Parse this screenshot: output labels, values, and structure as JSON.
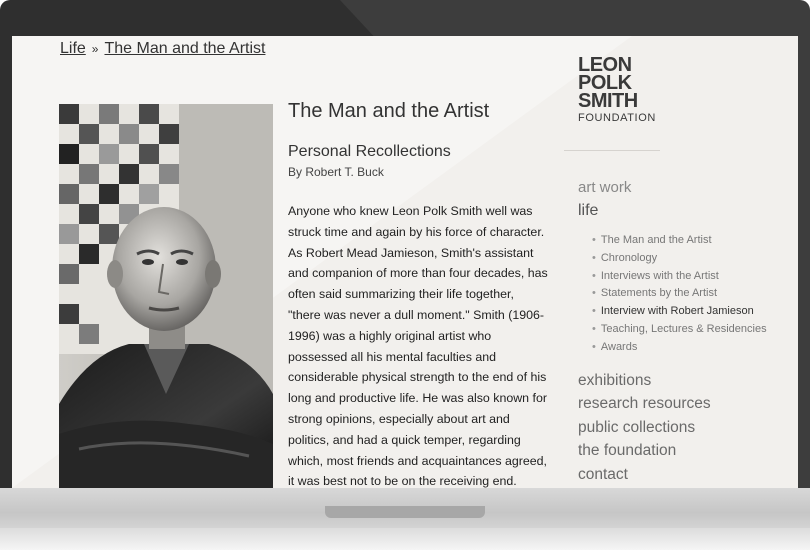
{
  "breadcrumb": {
    "root": "Life",
    "separator": "»",
    "current": "The Man and the Artist"
  },
  "logo": {
    "line1": "LEON",
    "line2": "POLK",
    "line3": "SMITH",
    "line4": "FOUNDATION"
  },
  "article": {
    "title": "The Man and the Artist",
    "subtitle": "Personal Recollections",
    "byline": "By Robert T. Buck",
    "body": "Anyone who knew Leon Polk Smith well was struck time and again by his force of character. As Robert Mead Jamieson, Smith's assistant and companion of more than four decades, has often said summarizing their life together, \"there was never a dull moment.\" Smith (1906-1996) was a highly original artist who possessed all his mental faculties and considerable physical strength to the end of his long and productive life. He was also known for strong opinions, especially about art and politics, and had a quick temper, regarding which, most friends and acquaintances agreed, it was best not to be on the receiving end."
  },
  "nav": {
    "art_work": "art work",
    "life": "life",
    "sub": [
      "The Man and the Artist",
      "Chronology",
      "Interviews with the Artist",
      "Statements by the Artist",
      "Interview with Robert Jamieson",
      "Teaching, Lectures & Residencies",
      "Awards"
    ],
    "exhibitions": "exhibitions",
    "research": "research resources",
    "collections": "public collections",
    "foundation": "the foundation",
    "contact": "contact"
  },
  "colors": {
    "page_bg": "#f2f0ed",
    "bezel": "#2f2f2f",
    "text": "#333333"
  }
}
